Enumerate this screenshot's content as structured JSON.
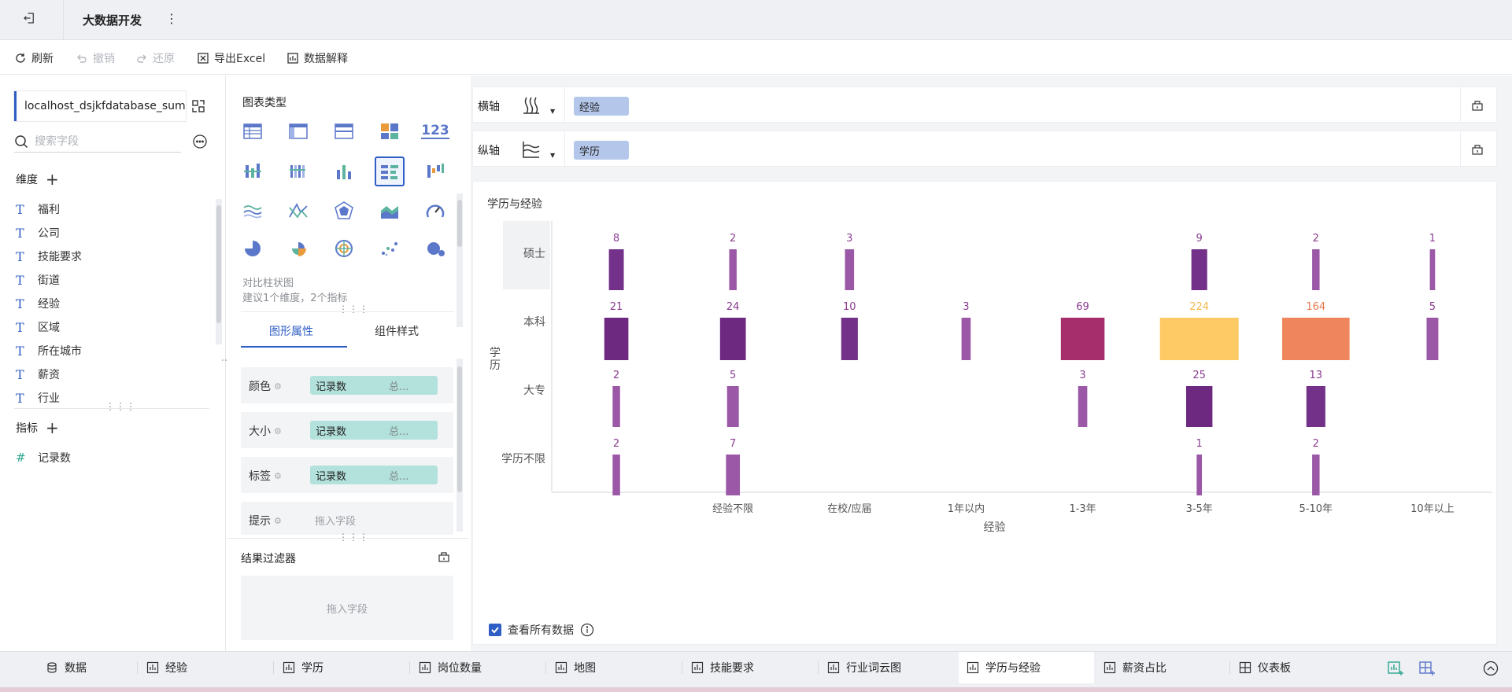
{
  "header": {
    "title": "大数据开发",
    "more_label": "⋮"
  },
  "toolbar": {
    "refresh": "刷新",
    "undo": "撤销",
    "redo": "还原",
    "export": "导出Excel",
    "explain": "数据解释"
  },
  "datasource": {
    "name": "localhost_dsjkfdatabase_sum"
  },
  "search": {
    "placeholder": "搜索字段"
  },
  "dimensions": {
    "title": "维度",
    "items": [
      "福利",
      "公司",
      "技能要求",
      "街道",
      "经验",
      "区域",
      "所在城市",
      "薪资",
      "行业"
    ]
  },
  "measures": {
    "title": "指标",
    "items": [
      "记录数"
    ]
  },
  "chart_types": {
    "title": "图表类型",
    "numeric_label": "123",
    "hint_name": "对比柱状图",
    "hint_desc": "建议1个维度，2个指标"
  },
  "prop_tabs": {
    "graphic": "图形属性",
    "style": "组件样式"
  },
  "props": [
    {
      "label": "颜色",
      "field": "记录数",
      "agg": "总..."
    },
    {
      "label": "大小",
      "field": "记录数",
      "agg": "总..."
    },
    {
      "label": "标签",
      "field": "记录数",
      "agg": "总..."
    },
    {
      "label": "提示",
      "placeholder": "拖入字段"
    }
  ],
  "filter": {
    "title": "结果过滤器",
    "placeholder": "拖入字段"
  },
  "axes": {
    "x_label": "横轴",
    "x_field": "经验",
    "y_label": "纵轴",
    "y_field": "学历"
  },
  "chart": {
    "title": "学历与经验",
    "view_all": "查看所有数据"
  },
  "chart_data": {
    "type": "bar",
    "title": "学历与经验",
    "xlabel": "经验",
    "ylabel": "学历",
    "categories": [
      "",
      "经验不限",
      "在校/应届",
      "1年以内",
      "1-3年",
      "3-5年",
      "5-10年",
      "10年以上"
    ],
    "rows": [
      "硕士",
      "本科",
      "大专",
      "学历不限"
    ],
    "series": [
      {
        "name": "硕士",
        "values": [
          8,
          2,
          3,
          null,
          null,
          9,
          2,
          1
        ]
      },
      {
        "name": "本科",
        "values": [
          21,
          24,
          10,
          3,
          69,
          224,
          164,
          5
        ]
      },
      {
        "name": "大专",
        "values": [
          2,
          5,
          null,
          null,
          3,
          25,
          13,
          null
        ]
      },
      {
        "name": "学历不限",
        "values": [
          2,
          7,
          null,
          null,
          null,
          1,
          2,
          null
        ]
      }
    ]
  },
  "bottom_tabs": [
    "数据",
    "经验",
    "学历",
    "岗位数量",
    "地图",
    "技能要求",
    "行业词云图",
    "学历与经验",
    "薪资占比",
    "仪表板"
  ],
  "bottom_active": "学历与经验"
}
